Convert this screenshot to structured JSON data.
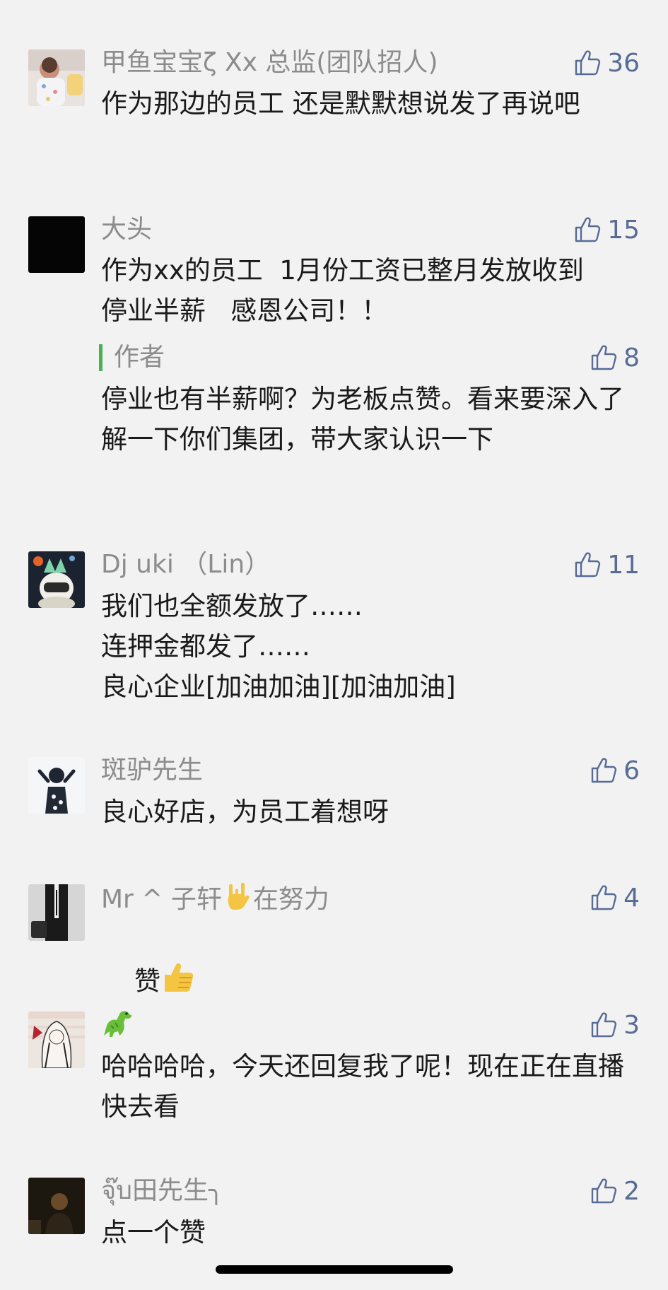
{
  "colors": {
    "background": "#f2f2f2",
    "name_gray": "#8c8c8c",
    "like_blue": "#576b95",
    "author_bar_green": "#4caf50"
  },
  "comments": [
    {
      "name": "甲鱼宝宝ζ Xx 总监(团队招人)",
      "likes": "36",
      "text": "作为那边的员工 还是默默想说发了再说吧",
      "avatar_icon": "baby-photo-avatar"
    },
    {
      "name": "大头",
      "likes": "15",
      "text": "作为xx的员工  1月份工资已整月发放收到  停业半薪   感恩公司！！",
      "avatar_icon": "black-avatar",
      "reply": {
        "label": "作者",
        "likes": "8",
        "text": "停业也有半薪啊？为老板点赞。看来要深入了解一下你们集团，带大家认识一下"
      }
    },
    {
      "name": "Dj uki （Lin）",
      "likes": "11",
      "text": "我们也全额发放了……\n连押金都发了……\n良心企业[加油加油][加油加油]",
      "avatar_icon": "masked-cat-avatar"
    },
    {
      "name": "斑驴先生",
      "likes": "6",
      "text": "良心好店，为员工着想呀",
      "avatar_icon": "person-photo-avatar"
    },
    {
      "name_prefix": "Mr ^ 子轩",
      "name_suffix": "在努力",
      "likes": "4",
      "text": "赞",
      "avatar_icon": "suit-man-avatar"
    },
    {
      "name": "",
      "likes": "3",
      "text": "哈哈哈哈，今天还回复我了呢！现在正在直播快去看",
      "avatar_icon": "anime-girl-avatar",
      "name_icon": "dinosaur-emoji"
    },
    {
      "name": "จุ๊บ田先生╮",
      "likes": "2",
      "text": "点一个赞",
      "avatar_icon": "dark-portrait-avatar"
    }
  ]
}
